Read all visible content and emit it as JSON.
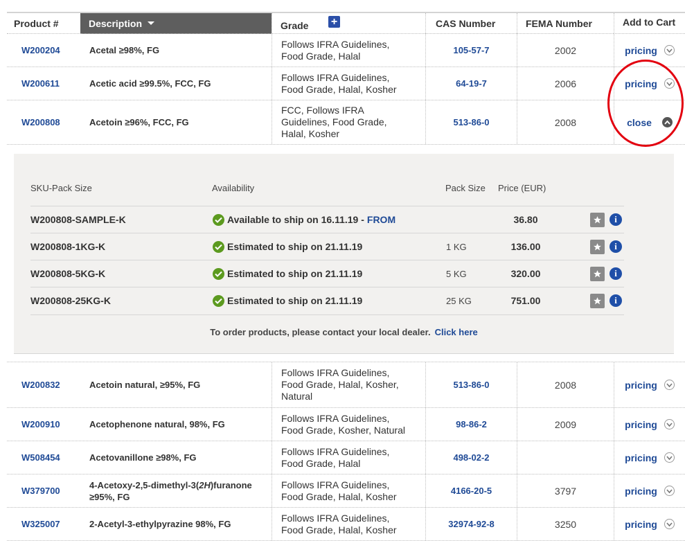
{
  "header": {
    "product": "Product #",
    "description": "Description",
    "grade": "Grade",
    "cas": "CAS Number",
    "fema": "FEMA Number",
    "cart": "Add to Cart"
  },
  "rows_top": [
    {
      "product": "W200204",
      "description": "Acetal ≥98%, FG",
      "grade": [
        "Follows IFRA Guidelines,",
        "Food Grade, Halal"
      ],
      "cas": "105-57-7",
      "fema": "2002",
      "action": "pricing"
    },
    {
      "product": "W200611",
      "description": "Acetic acid ≥99.5%, FCC, FG",
      "grade": [
        "Follows IFRA Guidelines,",
        "Food Grade, Halal, Kosher"
      ],
      "cas": "64-19-7",
      "fema": "2006",
      "action": "pricing"
    },
    {
      "product": "W200808",
      "description": "Acetoin ≥96%, FCC, FG",
      "grade": [
        "FCC, Follows IFRA",
        "Guidelines, Food Grade,",
        "Halal, Kosher"
      ],
      "cas": "513-86-0",
      "fema": "2008",
      "action": "close"
    }
  ],
  "panel": {
    "headers": {
      "sku": "SKU-Pack Size",
      "availability": "Availability",
      "pack": "Pack Size",
      "price": "Price (EUR)"
    },
    "items": [
      {
        "sku": "W200808-SAMPLE-K",
        "availability": "Available to ship on 16.11.19 -",
        "link": "FROM",
        "pack": "",
        "price": "36.80"
      },
      {
        "sku": "W200808-1KG-K",
        "availability": "Estimated to ship on 21.11.19",
        "link": "",
        "pack": "1 KG",
        "price": "136.00"
      },
      {
        "sku": "W200808-5KG-K",
        "availability": "Estimated to ship on 21.11.19",
        "link": "",
        "pack": "5 KG",
        "price": "320.00"
      },
      {
        "sku": "W200808-25KG-K",
        "availability": "Estimated to ship on 21.11.19",
        "link": "",
        "pack": "25 KG",
        "price": "751.00"
      }
    ],
    "footer_text": "To order products, please contact your local dealer.",
    "footer_link": "Click here"
  },
  "rows_bottom": [
    {
      "product": "W200832",
      "description": "Acetoin natural, ≥95%, FG",
      "grade": [
        "Follows IFRA Guidelines,",
        "Food Grade, Halal, Kosher,",
        "Natural"
      ],
      "cas": "513-86-0",
      "fema": "2008",
      "action": "pricing"
    },
    {
      "product": "W200910",
      "description": "Acetophenone natural, 98%, FG",
      "grade": [
        "Follows IFRA Guidelines,",
        "Food Grade, Kosher, Natural"
      ],
      "cas": "98-86-2",
      "fema": "2009",
      "action": "pricing"
    },
    {
      "product": "W508454",
      "description": "Acetovanillone ≥98%, FG",
      "grade": [
        "Follows IFRA Guidelines,",
        "Food Grade, Halal"
      ],
      "cas": "498-02-2",
      "fema": "",
      "action": "pricing"
    },
    {
      "product": "W379700",
      "description": [
        "4-Acetoxy-2,5-dimethyl-3(",
        "2H",
        ")furanone",
        "≥95%, FG"
      ],
      "grade": [
        "Follows IFRA Guidelines,",
        "Food Grade, Halal, Kosher"
      ],
      "cas": "4166-20-5",
      "fema": "3797",
      "action": "pricing"
    },
    {
      "product": "W325007",
      "description": "2-Acetyl-3-ethylpyrazine 98%, FG",
      "grade": [
        "Follows IFRA Guidelines,",
        "Food Grade, Halal, Kosher"
      ],
      "cas": "32974-92-8",
      "fema": "3250",
      "action": "pricing"
    }
  ],
  "colors": {
    "link": "#1f4a96",
    "header_active": "#5e5e5e",
    "check": "#5c9a1f",
    "highlight_circle": "#e3000f"
  },
  "icons": {
    "sort": "caret-down-icon",
    "add_column": "plus-icon",
    "expand": "chevron-down-icon",
    "collapse": "chevron-up-icon",
    "favorite": "star-icon",
    "info": "info-icon",
    "status": "check-circle-icon"
  }
}
